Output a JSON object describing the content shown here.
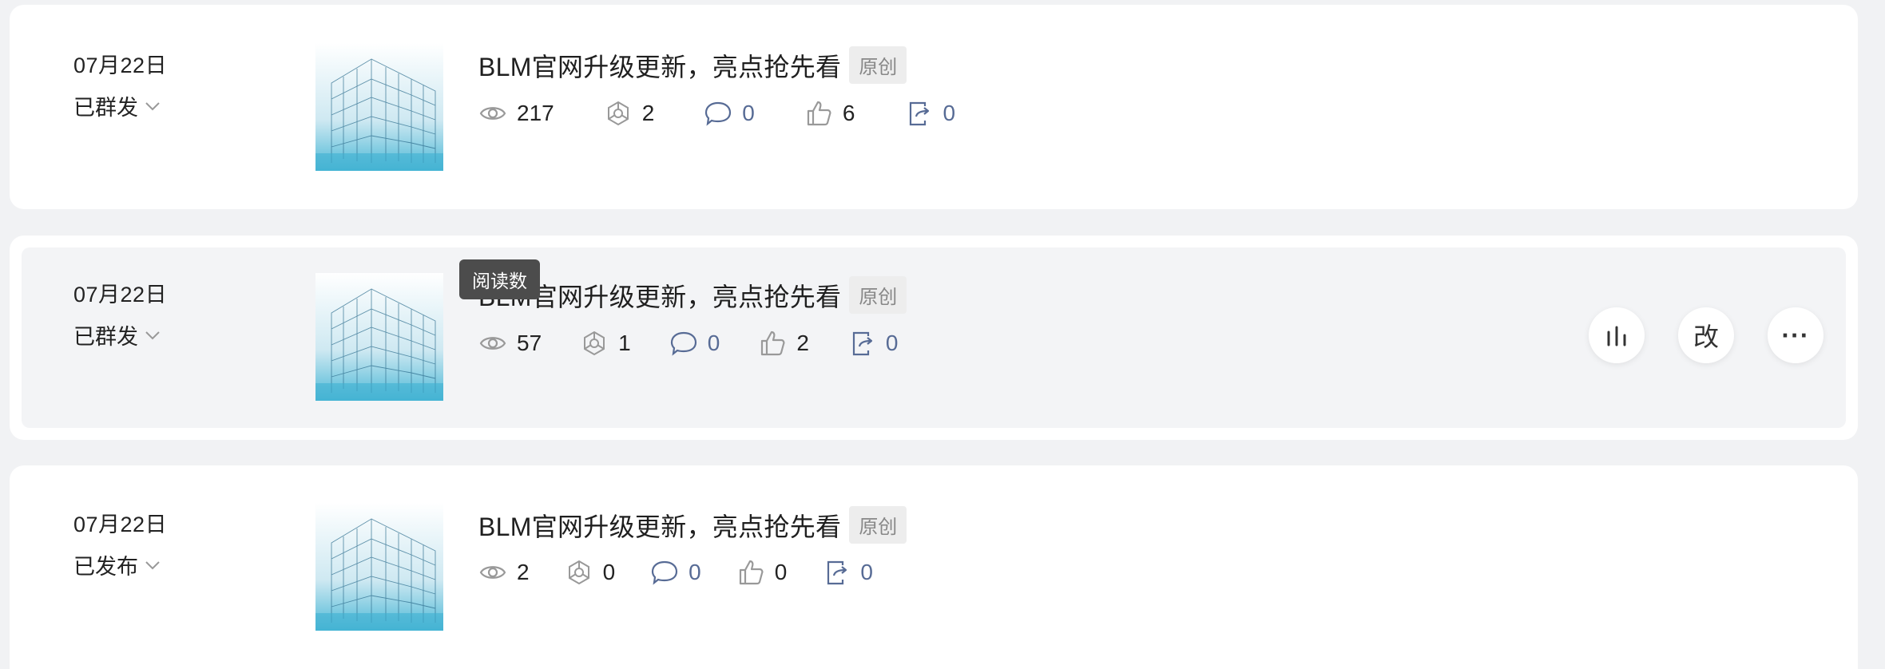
{
  "articles": [
    {
      "date": "07月22日",
      "status": "已群发",
      "title": "BLM官网升级更新，亮点抢先看",
      "tag": "原创",
      "stats": {
        "reads": "217",
        "shares": "2",
        "comments": "0",
        "likes": "6",
        "forwards": "0"
      }
    },
    {
      "date": "07月22日",
      "status": "已群发",
      "title": "BLM官网升级更新，亮点抢先看",
      "tag": "原创",
      "stats": {
        "reads": "57",
        "shares": "1",
        "comments": "0",
        "likes": "2",
        "forwards": "0"
      }
    },
    {
      "date": "07月22日",
      "status": "已发布",
      "title": "BLM官网升级更新，亮点抢先看",
      "tag": "原创",
      "stats": {
        "reads": "2",
        "shares": "0",
        "comments": "0",
        "likes": "0",
        "forwards": "0"
      }
    }
  ],
  "tooltip": {
    "text": "阅读数"
  },
  "actions": {
    "edit_label": "改",
    "more_label": "···"
  },
  "icons": [
    "eye-icon",
    "share-network-icon",
    "comment-icon",
    "thumbs-up-icon",
    "forward-icon",
    "bar-chart-icon",
    "chevron-down-icon"
  ],
  "colors": {
    "link": "#576b95",
    "background": "#f1f2f4",
    "hover_row": "#f3f4f6"
  }
}
